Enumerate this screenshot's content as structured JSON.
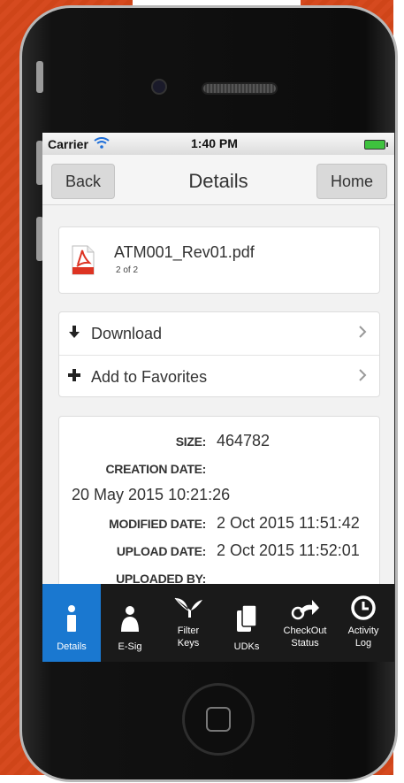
{
  "status_bar": {
    "carrier": "Carrier",
    "time": "1:40 PM"
  },
  "nav": {
    "back": "Back",
    "title": "Details",
    "home": "Home"
  },
  "file": {
    "name": "ATM001_Rev01.pdf",
    "count": "2 of 2",
    "icon": "pdf-icon"
  },
  "actions": [
    {
      "icon": "download-icon",
      "label": "Download"
    },
    {
      "icon": "plus-icon",
      "label": "Add to Favorites"
    }
  ],
  "meta": {
    "size_label": "SIZE:",
    "size_value": "464782",
    "creation_label": "CREATION DATE:",
    "creation_value": "20 May 2015 10:21:26",
    "modified_label": "MODIFIED DATE:",
    "modified_value": "2 Oct 2015 11:51:42",
    "upload_label": "UPLOAD DATE:",
    "upload_value": "2 Oct 2015 11:52:01",
    "uploaded_by_label": "UPLOADED BY:"
  },
  "tabs": [
    {
      "icon": "info-icon",
      "label": "Details",
      "active": true
    },
    {
      "icon": "person-icon",
      "label": "E-Sig"
    },
    {
      "icon": "filter-keys-icon",
      "label": "Filter Keys"
    },
    {
      "icon": "udks-icon",
      "label": "UDKs"
    },
    {
      "icon": "checkout-icon",
      "label": "CheckOut Status"
    },
    {
      "icon": "clock-icon",
      "label": "Activity Log"
    }
  ],
  "colors": {
    "accent": "#1a78d0",
    "background": "#d64a1f"
  }
}
